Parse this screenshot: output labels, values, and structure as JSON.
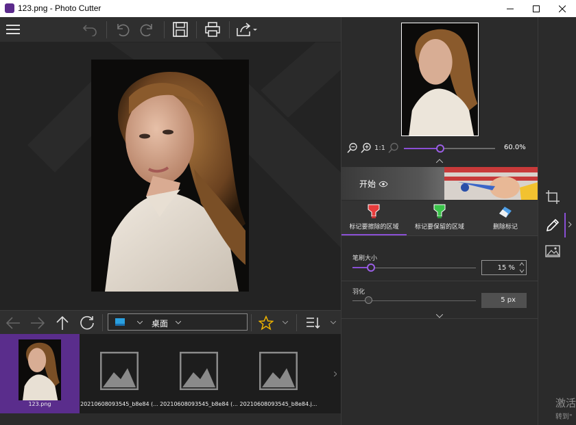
{
  "window": {
    "title": "123.png - Photo Cutter"
  },
  "colors": {
    "accent": "#8a4fd6",
    "selected_thumb": "#5a2d8c"
  },
  "toolbar": {
    "icons": [
      "menu-icon",
      "back-icon",
      "undo-icon",
      "redo-icon",
      "save-icon",
      "print-icon",
      "share-icon"
    ]
  },
  "nav": {
    "path_label": "桌面"
  },
  "thumbnails": [
    {
      "label": "123.png",
      "selected": true
    },
    {
      "label": "20210608093545_b8e84 (..."
    },
    {
      "label": "20210608093545_b8e84 (..."
    },
    {
      "label": "20210608093545_b8e84.j..."
    }
  ],
  "zoom": {
    "value_label": "60.0%",
    "one_to_one_label": "1:1",
    "level": 0.4
  },
  "banner": {
    "label": "开始"
  },
  "modes": [
    {
      "label": "标记要擦除的区域",
      "selected": true
    },
    {
      "label": "标记要保留的区域"
    },
    {
      "label": "删除标记"
    }
  ],
  "brush": {
    "label": "笔刷大小",
    "value": "15 %",
    "level": 0.15
  },
  "feather": {
    "label": "羽化",
    "value": "5 px",
    "level": 0.13
  },
  "watermark": {
    "line1": "激活",
    "line2": "转到\""
  }
}
